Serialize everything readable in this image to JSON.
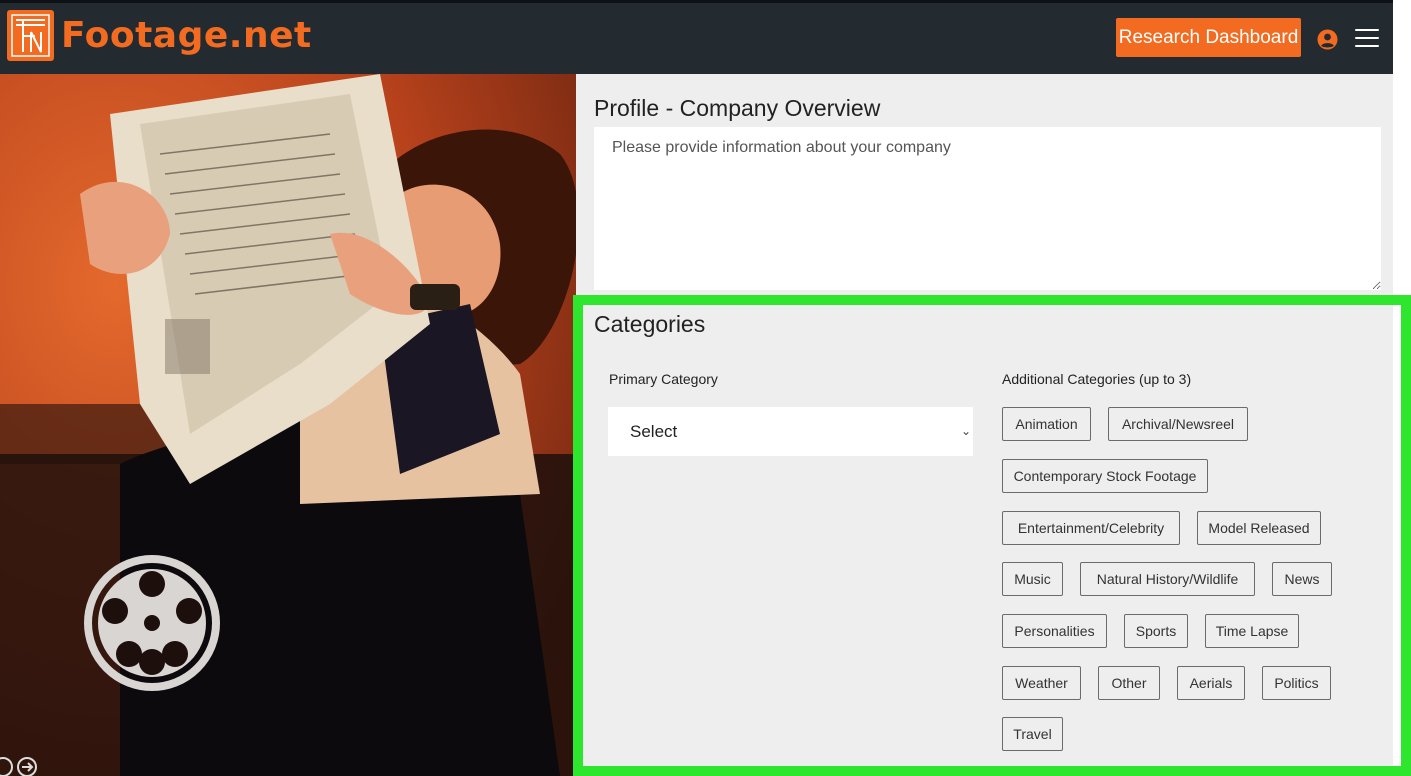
{
  "brand": {
    "name": "Footage.net",
    "accent": "#f26b21"
  },
  "header": {
    "research_button": "Research Dashboard",
    "user_icon": "user-circle-icon",
    "menu_icon": "hamburger-menu-icon",
    "background": "#232a30"
  },
  "profile": {
    "title": "Profile - Company Overview",
    "overview_placeholder": "Please provide information about your company",
    "overview_value": ""
  },
  "categories": {
    "title": "Categories",
    "highlight_color": "#2ee62e",
    "primary": {
      "label": "Primary Category",
      "selected": "Select"
    },
    "additional": {
      "label": "Additional Categories (up to 3)",
      "options": [
        "Animation",
        "Archival/Newsreel",
        "Contemporary Stock Footage",
        "Entertainment/Celebrity",
        "Model Released",
        "Music",
        "Natural History/Wildlife",
        "News",
        "Personalities",
        "Sports",
        "Time Lapse",
        "Weather",
        "Other",
        "Aerials",
        "Politics",
        "Travel"
      ]
    }
  }
}
